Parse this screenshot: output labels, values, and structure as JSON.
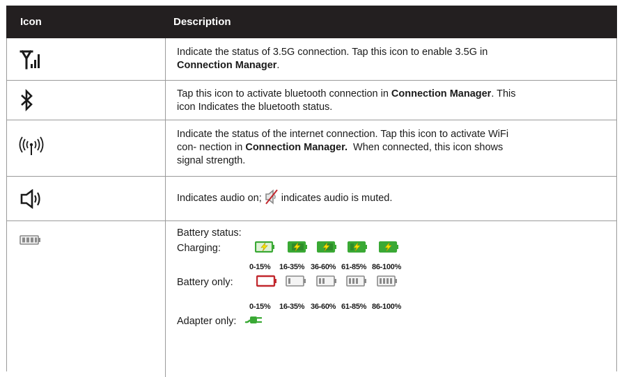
{
  "header": {
    "col_icon": "Icon",
    "col_description": "Description"
  },
  "rows": [
    {
      "icon": "signal-3-5g-icon",
      "line1": "Indicate the status of 3.5G connection. Tap this icon to enable 3.5G in",
      "bold": "Connection Manager",
      "tail": "."
    },
    {
      "icon": "bluetooth-icon",
      "line1_pre": "Tap this icon to activate bluetooth connection in ",
      "bold": "Connection Manager",
      "line1_post": ". This",
      "line2": "icon Indicates the bluetooth status."
    },
    {
      "icon": "wifi-antenna-icon",
      "line1": "Indicate the status of the internet connection. Tap this icon to activate WiFi",
      "line2_pre": "con- nection in ",
      "bold": "Connection Manager.",
      "line2_post": "  When connected, this icon shows",
      "line3": "signal strength."
    },
    {
      "icon": "speaker-icon",
      "pre": "Indicates audio on; ",
      "muted_icon": "speaker-muted-icon",
      "post": " indicates audio is muted."
    },
    {
      "icon": "battery-icon",
      "title": "Battery status:",
      "charging_label": "Charging:",
      "battery_only_label": "Battery only:",
      "adapter_only_label": "Adapter only:",
      "ranges": [
        "0-15%",
        "16-35%",
        "36-60%",
        "61-85%",
        "86-100%"
      ]
    }
  ],
  "colors": {
    "header_bg": "#231f20",
    "charging_green": "#3aa935",
    "bolt_yellow": "#f5e400",
    "low_battery_red": "#c1272d",
    "battery_gray": "#8a8a8a"
  }
}
